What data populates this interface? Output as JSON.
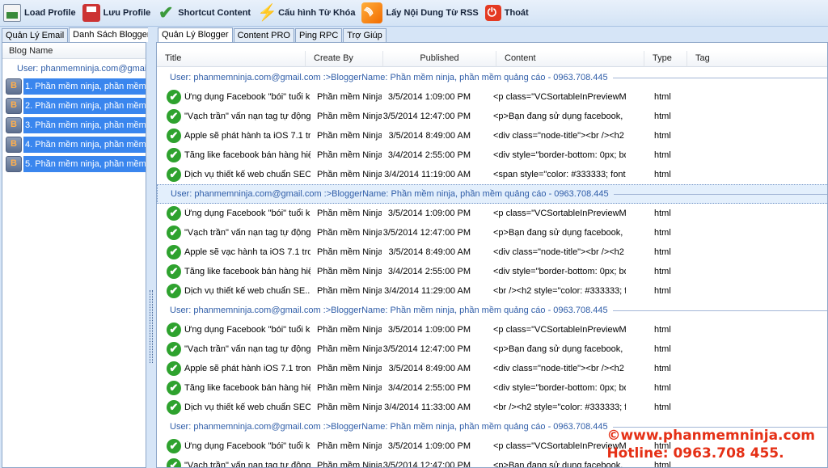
{
  "toolbar": {
    "items": [
      {
        "label": "Load Profile",
        "icon": "load-profile-icon"
      },
      {
        "label": "Lưu Profile",
        "icon": "save-icon"
      },
      {
        "label": "Shortcut Content",
        "icon": "check-icon"
      },
      {
        "label": "Cấu hình Từ Khóa",
        "icon": "lightning-icon"
      },
      {
        "label": "Lấy Nội Dung Từ RSS",
        "icon": "rss-icon"
      },
      {
        "label": "Thoát",
        "icon": "power-icon"
      }
    ]
  },
  "left": {
    "tabs": [
      "Quản Lý Email",
      "Danh Sách Blogger"
    ],
    "column": "Blog Name",
    "user": "User: phanmemninja.com@gmail.com",
    "blogs": [
      "1. Phần mềm ninja, phần mềm quảng cáo",
      "2. Phần mềm ninja, phần mềm quảng cáo",
      "3. Phần mềm ninja, phần mềm quảng cáo",
      "4. Phần mềm ninja, phần mềm quảng cáo",
      "5. Phần mềm ninja, phần mềm quảng cáo"
    ]
  },
  "right": {
    "tabs": [
      "Quản Lý Blogger",
      "Content PRO",
      "Ping RPC",
      "Trợ Giúp"
    ],
    "columns": [
      "Title",
      "Create By",
      "Published",
      "Content",
      "Type",
      "Tag"
    ],
    "groups": [
      {
        "header": "User: phanmemninja.com@gmail.com :>BloggerName: Phần mềm ninja, phần mềm quảng cáo - 0963.708.445",
        "rows": [
          {
            "title": "Ứng dụng Facebook \"bói\" tuổi k...",
            "by": "Phần mềm Ninja",
            "published": "3/5/2014 1:09:00 PM",
            "content": "<p class=\"VCSortableInPreviewMode...",
            "type": "html"
          },
          {
            "title": "\"Vạch trần\" vấn nạn tag tự động ...",
            "by": "Phần mềm Ninja",
            "published": "3/5/2014 12:47:00 PM",
            "content": "<p>Bạn đang sử dụng facebook, bốn...",
            "type": "html"
          },
          {
            "title": "Apple sẽ phát hành ta iOS 7.1 tro...",
            "by": "Phần mềm Ninja",
            "published": "3/5/2014 8:49:00 AM",
            "content": "<div class=\"node-title\"><br /><h2 cla...",
            "type": "html"
          },
          {
            "title": "Tăng like facebook bán hàng hiệ...",
            "by": "Phần mềm Ninja",
            "published": "3/4/2014 2:55:00 PM",
            "content": "<div style=\"border-bottom: 0px; border...",
            "type": "html"
          },
          {
            "title": "Dịch vụ thiết kế web chuẩn SEO ...",
            "by": "Phần mềm Ninja",
            "published": "3/4/2014 11:19:00 AM",
            "content": "<span style=\"color: #333333; font-fa...",
            "type": "html"
          }
        ]
      },
      {
        "header": "User: phanmemninja.com@gmail.com :>BloggerName: Phần mềm ninja, phần mềm quảng cáo - 0963.708.445",
        "rows": [
          {
            "title": "Ứng dụng Facebook \"bói\" tuổi k...",
            "by": "Phần mềm Ninja",
            "published": "3/5/2014 1:09:00 PM",
            "content": "<p class=\"VCSortableInPreviewMode...",
            "type": "html"
          },
          {
            "title": "\"Vạch trần\" vấn nạn tag tự động ...",
            "by": "Phần mềm Ninja",
            "published": "3/5/2014 12:47:00 PM",
            "content": "<p>Bạn đang sử dụng facebook, bốn...",
            "type": "html"
          },
          {
            "title": "Apple sẽ vạc hành ta iOS 7.1 tro...",
            "by": "Phần mềm Ninja",
            "published": "3/5/2014 8:49:00 AM",
            "content": "<div class=\"node-title\"><br /><h2 cla...",
            "type": "html"
          },
          {
            "title": "Tăng like facebook bán hàng hiệ...",
            "by": "Phần mềm Ninja",
            "published": "3/4/2014 2:55:00 PM",
            "content": "<div style=\"border-bottom: 0px; border...",
            "type": "html"
          },
          {
            "title": "Dịch vụ thiết kế web chuẩn SE...",
            "by": "Phần mềm Ninja",
            "published": "3/4/2014 11:29:00 AM",
            "content": "<br /><h2 style=\"color: #333333; font...",
            "type": "html"
          }
        ]
      },
      {
        "header": "User: phanmemninja.com@gmail.com :>BloggerName: Phần mềm ninja, phần mềm quảng cáo - 0963.708.445",
        "rows": [
          {
            "title": "Ứng dụng Facebook \"bói\" tuổi k...",
            "by": "Phần mềm Ninja",
            "published": "3/5/2014 1:09:00 PM",
            "content": "<p class=\"VCSortableInPreviewMode...",
            "type": "html"
          },
          {
            "title": "\"Vạch trần\" vấn nạn tag tự động ...",
            "by": "Phần mềm Ninja",
            "published": "3/5/2014 12:47:00 PM",
            "content": "<p>Bạn đang sử dụng facebook, bốn...",
            "type": "html"
          },
          {
            "title": "Apple sẽ phát hành iOS 7.1 trong...",
            "by": "Phần mềm Ninja",
            "published": "3/5/2014 8:49:00 AM",
            "content": "<div class=\"node-title\"><br /><h2 cla...",
            "type": "html"
          },
          {
            "title": "Tăng like facebook bán hàng hiệ...",
            "by": "Phần mềm Ninja",
            "published": "3/4/2014 2:55:00 PM",
            "content": "<div style=\"border-bottom: 0px; border...",
            "type": "html"
          },
          {
            "title": "Dịch vụ thiết kế web chuẩn SEO ...",
            "by": "Phần mềm Ninja",
            "published": "3/4/2014 11:33:00 AM",
            "content": "<br /><h2 style=\"color: #333333; font...",
            "type": "html"
          }
        ]
      },
      {
        "header": "User: phanmemninja.com@gmail.com :>BloggerName: Phần mềm ninja, phần mềm quảng cáo - 0963.708.445",
        "rows": [
          {
            "title": "Ứng dụng Facebook \"bói\" tuổi k...",
            "by": "Phần mềm Ninja",
            "published": "3/5/2014 1:09:00 PM",
            "content": "<p class=\"VCSortableInPreviewMode...",
            "type": "html"
          },
          {
            "title": "\"Vạch trần\" vấn nạn tag tự động ...",
            "by": "Phần mềm Ninja",
            "published": "3/5/2014 12:47:00 PM",
            "content": "<p>Bạn đang sử dụng facebook, bốn...",
            "type": "html"
          }
        ]
      }
    ]
  },
  "watermark": {
    "line1": "©www.phanmemninja.com",
    "line2": "Hotline: 0963.708 455."
  }
}
